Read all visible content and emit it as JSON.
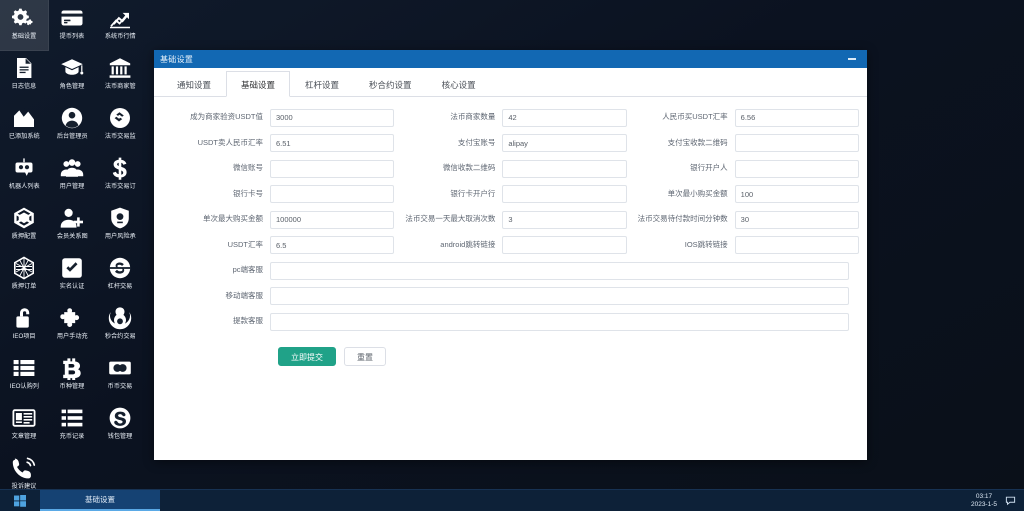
{
  "desktop": {
    "icons": [
      {
        "label": "基础设置",
        "icon": "gears-icon",
        "selected": true
      },
      {
        "label": "提币列表",
        "icon": "credit-card-icon",
        "selected": false
      },
      {
        "label": "系统币行情",
        "icon": "chart-line-icon",
        "selected": false
      },
      {
        "label": "日志信息",
        "icon": "document-icon",
        "selected": false
      },
      {
        "label": "角色管理",
        "icon": "graduation-cap-icon",
        "selected": false
      },
      {
        "label": "法币商家管",
        "icon": "bank-icon",
        "selected": false
      },
      {
        "label": "已添加系统",
        "icon": "area-chart-icon",
        "selected": false
      },
      {
        "label": "后台管理员",
        "icon": "user-circle-icon",
        "selected": false
      },
      {
        "label": "法币交易监",
        "icon": "coin-link-icon",
        "selected": false
      },
      {
        "label": "机器人列表",
        "icon": "robot-icon",
        "selected": false
      },
      {
        "label": "用户管理",
        "icon": "users-icon",
        "selected": false
      },
      {
        "label": "法币交易订",
        "icon": "dollar-icon",
        "selected": false
      },
      {
        "label": "质押配置",
        "icon": "cube-icon",
        "selected": false
      },
      {
        "label": "会员关系图",
        "icon": "user-plus-icon",
        "selected": false
      },
      {
        "label": "用户风险承",
        "icon": "shield-icon",
        "selected": false
      },
      {
        "label": "质押订单",
        "icon": "hexagon-mesh-icon",
        "selected": false
      },
      {
        "label": "实名认证",
        "icon": "check-square-icon",
        "selected": false
      },
      {
        "label": "杠杆交易",
        "icon": "circle-s-icon",
        "selected": false
      },
      {
        "label": "IEO项目",
        "icon": "unlock-icon",
        "selected": false
      },
      {
        "label": "用户手动充",
        "icon": "puzzle-icon",
        "selected": false
      },
      {
        "label": "秒合约交易",
        "icon": "rebel-icon",
        "selected": false
      },
      {
        "label": "IEO认购列",
        "icon": "list-icon",
        "selected": false
      },
      {
        "label": "币种管理",
        "icon": "bitcoin-icon",
        "selected": false
      },
      {
        "label": "币币交易",
        "icon": "money-icon",
        "selected": false
      },
      {
        "label": "文章管理",
        "icon": "newspaper-icon",
        "selected": false
      },
      {
        "label": "充币记录",
        "icon": "bars-list-icon",
        "selected": false
      },
      {
        "label": "钱包管理",
        "icon": "skype-icon",
        "selected": false
      },
      {
        "label": "投诉建议",
        "icon": "phone-volume-icon",
        "selected": false
      }
    ]
  },
  "window": {
    "title": "基础设置",
    "minimize_label": "—",
    "tabs": [
      {
        "label": "通知设置",
        "active": false
      },
      {
        "label": "基础设置",
        "active": true
      },
      {
        "label": "杠杆设置",
        "active": false
      },
      {
        "label": "秒合约设置",
        "active": false
      },
      {
        "label": "核心设置",
        "active": false
      }
    ],
    "form": {
      "rows": [
        [
          {
            "label": "成为商家验资USDT值",
            "value": "3000",
            "placeholder": ""
          },
          {
            "label": "法币商家数量",
            "value": "42",
            "placeholder": ""
          },
          {
            "label": "人民币买USDT汇率",
            "value": "6.56",
            "placeholder": ""
          }
        ],
        [
          {
            "label": "USDT卖人民币汇率",
            "value": "6.51",
            "placeholder": ""
          },
          {
            "label": "支付宝账号",
            "value": "alipay",
            "placeholder": ""
          },
          {
            "label": "支付宝收款二维码",
            "value": "",
            "placeholder": ""
          }
        ],
        [
          {
            "label": "微信账号",
            "value": "",
            "placeholder": ""
          },
          {
            "label": "微信收款二维码",
            "value": "",
            "placeholder": ""
          },
          {
            "label": "银行开户人",
            "value": "",
            "placeholder": ""
          }
        ],
        [
          {
            "label": "银行卡号",
            "value": "",
            "placeholder": ""
          },
          {
            "label": "银行卡开户行",
            "value": "",
            "placeholder": ""
          },
          {
            "label": "单次最小购买金额",
            "value": "100",
            "placeholder": ""
          }
        ],
        [
          {
            "label": "单次最大购买金额",
            "value": "100000",
            "placeholder": ""
          },
          {
            "label": "法币交易一天最大取消次数",
            "value": "3",
            "placeholder": ""
          },
          {
            "label": "法币交易待付款时间分钟数",
            "value": "30",
            "placeholder": ""
          }
        ],
        [
          {
            "label": "USDT汇率",
            "value": "6.5",
            "placeholder": ""
          },
          {
            "label": "android跳转链接",
            "value": "",
            "placeholder": ""
          },
          {
            "label": "IOS跳转链接",
            "value": "",
            "placeholder": ""
          }
        ]
      ],
      "full_rows": [
        {
          "label": "pc端客服",
          "value": "",
          "placeholder": ""
        },
        {
          "label": "移动端客服",
          "value": "",
          "placeholder": ""
        },
        {
          "label": "提款客服",
          "value": "",
          "placeholder": ""
        }
      ],
      "submit_label": "立即提交",
      "reset_label": "重置"
    }
  },
  "taskbar": {
    "start_label": "start-button",
    "task_item_label": "基础设置",
    "clock_time": "03:17",
    "clock_date": "2023-1-5",
    "notification_label": "notifications"
  },
  "colors": {
    "titlebar": "#1268b3",
    "primary_button": "#20a288",
    "taskbar": "#0d2138",
    "desktop": "#0b1220"
  }
}
